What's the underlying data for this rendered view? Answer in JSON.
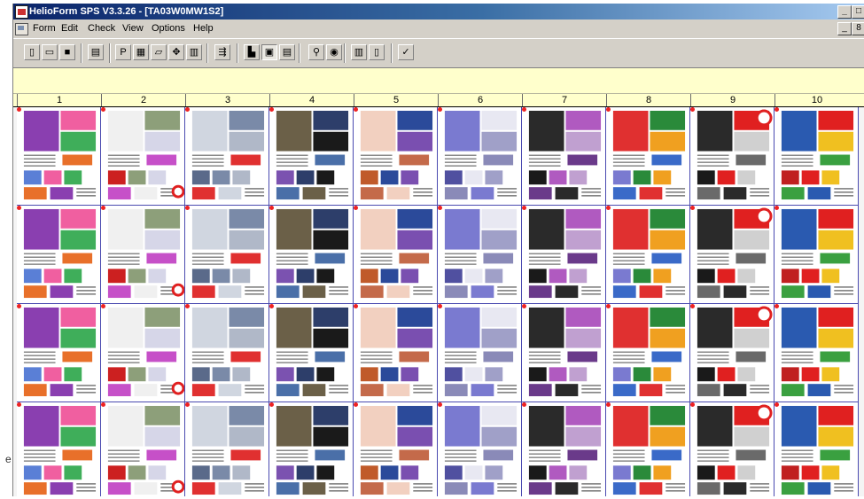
{
  "app": {
    "title": "HelioForm  SPS V3.3.26 - [TA03W0MW1S2]",
    "window_buttons": [
      "_",
      "□"
    ],
    "doc_buttons": [
      "_",
      "8"
    ]
  },
  "menu": [
    "Form",
    "Edit",
    "Check",
    "View",
    "Options",
    "Help"
  ],
  "toolbar": [
    {
      "name": "new-icon",
      "glyph": "▯"
    },
    {
      "name": "open-icon",
      "glyph": "▭"
    },
    {
      "name": "save-icon",
      "glyph": "■"
    },
    {
      "name": "print-icon",
      "glyph": "▤"
    },
    {
      "name": "page-icon",
      "glyph": "P"
    },
    {
      "name": "grid-icon",
      "glyph": "▦"
    },
    {
      "name": "layout-icon",
      "glyph": "▱"
    },
    {
      "name": "move-icon",
      "glyph": "✥"
    },
    {
      "name": "list-icon",
      "glyph": "▥"
    },
    {
      "name": "arrange-icon",
      "glyph": "⇶"
    },
    {
      "name": "chart-icon",
      "glyph": "▙"
    },
    {
      "name": "frame-icon",
      "glyph": "▣"
    },
    {
      "name": "table-view-icon",
      "glyph": "▤"
    },
    {
      "name": "zoom-icon",
      "glyph": "⚲"
    },
    {
      "name": "target-icon",
      "glyph": "◉"
    },
    {
      "name": "panel-icon",
      "glyph": "▥"
    },
    {
      "name": "book-icon",
      "glyph": "▯"
    },
    {
      "name": "check-icon",
      "glyph": "✓"
    }
  ],
  "columns": [
    "1",
    "2",
    "3",
    "4",
    "5",
    "6",
    "7",
    "8",
    "9",
    "10"
  ],
  "rows": 4,
  "stray_text": "e",
  "colors": {
    "title_start": "#0a246a",
    "title_end": "#a6caf0",
    "header_bg": "#ffffcc",
    "page_border": "#4a4ab0",
    "accent_red": "#e22222"
  }
}
